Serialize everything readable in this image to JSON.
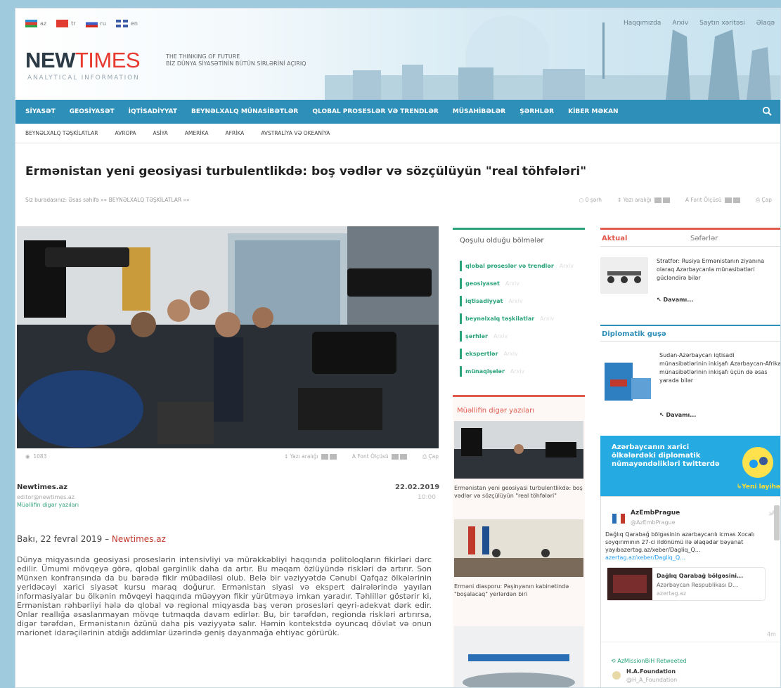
{
  "languages": [
    {
      "code": "az",
      "flag": "#3d8fd0"
    },
    {
      "code": "tr",
      "flag": "#e13c2f"
    },
    {
      "code": "ru",
      "flag": "#4a6fc7"
    },
    {
      "code": "en",
      "flag": "#3b5aa8"
    }
  ],
  "toplinks": [
    "Haqqımızda",
    "Arxiv",
    "Saytın xəritəsi",
    "Əlaqə"
  ],
  "logo": {
    "part1": "NEW",
    "part2": "TIMES",
    "sub": "ANALYTICAL INFORMATION"
  },
  "tagline": {
    "line1": "THE THINKING OF FUTURE",
    "line2": "BİZ DÜNYA SİYASƏTİNİN BÜTÜN SİRLƏRİNİ AÇIRIQ"
  },
  "nav": [
    "SİYASƏT",
    "GEOSİYASƏT",
    "İQTİSADİYYAT",
    "BEYNƏLXALQ MÜNASİBƏTLƏR",
    "QLOBAL PROSESLƏR VƏ TRENDLƏR",
    "MÜSAHİBƏLƏR",
    "ŞƏRHLƏR",
    "KİBER MƏKAN"
  ],
  "subnav": [
    "BEYNƏLXALQ TƏŞKİLATLAR",
    "AVROPA",
    "ASİYA",
    "AMERİKA",
    "AFRİKA",
    "AVSTRALİYA VƏ OKEANİYA"
  ],
  "article": {
    "title": "Ermənistan yeni geosiyasi turbulentlikdə: boş vədlər və sözçülüyün \"real töhfələri\"",
    "crumb": "Siz buradasınız: Əsas səhifə »» BEYNƏLXALQ TƏŞKİLATLAR »»",
    "tools": {
      "comment": "0 şərh",
      "spacing": "Yazı aralığı",
      "font": "Font Ölçüsü",
      "print": "Çap"
    },
    "views": "1083",
    "author": "Newtimes.az",
    "email": "editor@newtimes.az",
    "other": "Müəllifin digər yazıları",
    "date": "22.02.2019",
    "time": "10:00",
    "lead_city": "Bakı, 22 fevral 2019 – ",
    "lead_site": "Newtimes.az",
    "body": "Dünya miqyasında geosiyasi proseslərin intensivliyi və mürəkkəbliyi haqqında politoloqların fikirləri dərc edilir. Ümumi mövqeyə görə, qlobal gərginlik daha da artır. Bu məqam özlüyündə riskləri də artırır. Son Münxen konfransında da bu barədə fikir mübadiləsi olub. Belə bir vəziyyətdə Cənubi Qafqaz ölkələrinin yeridəcəyi xarici siyasət kursu maraq doğurur. Ermənistan siyasi və ekspert dairələrində yayılan informasiyalar bu ölkənin mövqeyi haqqında müəyyən fikir yürütməyə imkan yaradır. Təhlillər göstərir ki, Ermənistan rəhbərliyi hələ də qlobal və regional miqyasda baş verən prosesləri qeyri-adekvat dərk edir. Onlar reallığa əsaslanmayan mövqe tutmaqda davam edirlər. Bu, bir tərəfdən, regionda riskləri artırırsa, digər tərəfdən, Ermənistanın özünü daha pis vəziyyətə salır. Həmin kontekstdə oyuncaq dövlət və onun marionet idarəçilərinin atdığı addımlar üzərində geniş dayanmağa ehtiyac görürük."
  },
  "categories": {
    "title": "Qoşulu olduğu bölmələr",
    "items": [
      "qlobal proseslər və trendlər",
      "geosiyasət",
      "iqtisadiyyat",
      "beynəlxalq təşkilatlar",
      "şərhlər",
      "ekspertlər",
      "münaqişələr"
    ],
    "archive": "Arxiv"
  },
  "more": {
    "title": "Müəllifin digər yazıları",
    "items": [
      "Ermənistan yeni geosiyasi turbulentlikdə: boş vədlər və sözçülüyün \"real töhfələri\"",
      "Erməni diasporu: Paşinyanın kabinetində \"boşalacaq\" yerlərdən biri"
    ]
  },
  "aktual": {
    "tab1": "Aktual",
    "tab2": "Səfərlər",
    "story": "Stratfor: Rusiya Ermənistanın ziyanına olaraq Azərbaycanla münasibətləri gücləndirə bilər",
    "more": "Davamı..."
  },
  "diplo": {
    "title": "Diplomatik guşə",
    "story": "Sudan-Azərbaycan iqtisadi münasibətlərinin inkişafı Azərbaycan-Afrika münasibətlərinin inkişafı üçün də əsas yarada bilər",
    "more": "Davamı..."
  },
  "twitter_banner": {
    "text": "Azərbaycanın xarici ölkələrdəki diplomatik nümayəndəlikləri twitterdə",
    "new": "↳Yeni layihə"
  },
  "tweets": {
    "name1": "AzEmbPrague",
    "handle1": "@AzEmbPrague",
    "text1": "Dağlıq Qarabağ bölgəsinin azərbaycanlı icmas Xocalı soyqırımının 27-ci ildönümü ilə əlaqədar bəyanat yayıbazertag.az/xeber/Dagliq_Q...",
    "link1": "azertag.az/xeber/Dagliq_Q...",
    "card_title": "Dağlıq Qarabağ bölgəsini...",
    "card_sub": "Azərbaycan Respublikası D...",
    "card_src": "azertag.az",
    "time": "4m",
    "retweet": "AzMissionBiH Retweeted",
    "name2": "H.A.Foundation",
    "handle2": "@H_A_Foundation"
  }
}
